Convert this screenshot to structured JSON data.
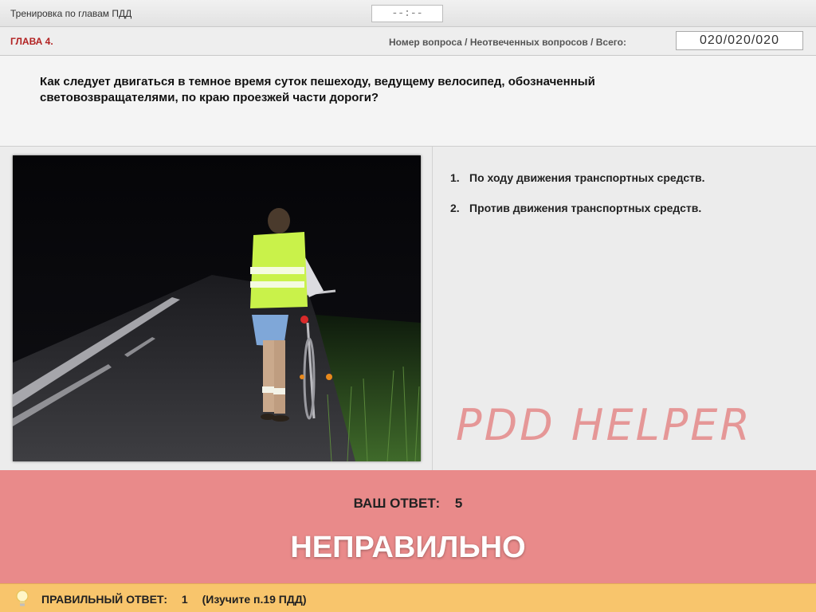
{
  "app_title": "Тренировка по главам ПДД",
  "timer": "--:--",
  "chapter": "ГЛАВА 4.",
  "counter_label": "Номер вопроса / Неотвеченных вопросов / Всего:",
  "counter_value": "020/020/020",
  "question": "Как следует двигаться в темное время суток пешеходу, ведущему велосипед, обозначенный световозвращателями, по краю проезжей части дороги?",
  "answers": [
    {
      "num": "1.",
      "text": "По ходу движения транспортных средств."
    },
    {
      "num": "2.",
      "text": "Против движения транспортных средств."
    }
  ],
  "watermark": "PDD HELPER",
  "result": {
    "your_answer_label": "ВАШ ОТВЕТ:",
    "your_answer_value": "5",
    "verdict": "НЕПРАВИЛЬНО"
  },
  "correct": {
    "label": "ПРАВИЛЬНЫЙ ОТВЕТ:",
    "value": "1",
    "hint": "(Изучите п.19 ПДД)"
  },
  "icons": {
    "hint": "lightbulb-icon"
  },
  "colors": {
    "result_bg": "#e98a8a",
    "correct_bg": "#f8c56c",
    "chapter": "#b22222",
    "watermark": "#e26a6a"
  }
}
